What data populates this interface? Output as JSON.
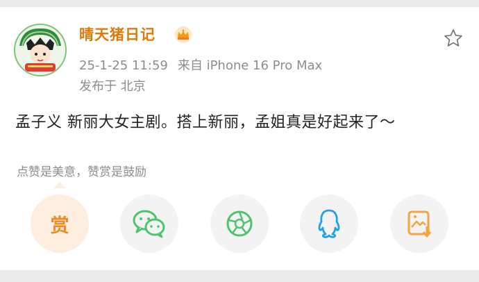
{
  "post": {
    "username": "晴天猪日记",
    "date": "25-1-25 11:59",
    "source": "来自 iPhone 16 Pro Max",
    "location": "发布于 北京",
    "text": "孟子义 新丽大女主剧。搭上新丽，孟姐真是好起来了～"
  },
  "reward": {
    "hint": "点赞是美意，赞赏是鼓励",
    "button_label": "赏"
  },
  "icons": {
    "crown": "crown-icon",
    "favorite": "star-icon",
    "share_targets": [
      "wechat-icon",
      "moments-icon",
      "qq-icon",
      "save-image-icon"
    ]
  },
  "colors": {
    "username": "#e0780a",
    "reward_accent": "#f08a24",
    "wechat": "#4cc46b",
    "qq": "#1ea1e8",
    "save": "#f2a541"
  }
}
